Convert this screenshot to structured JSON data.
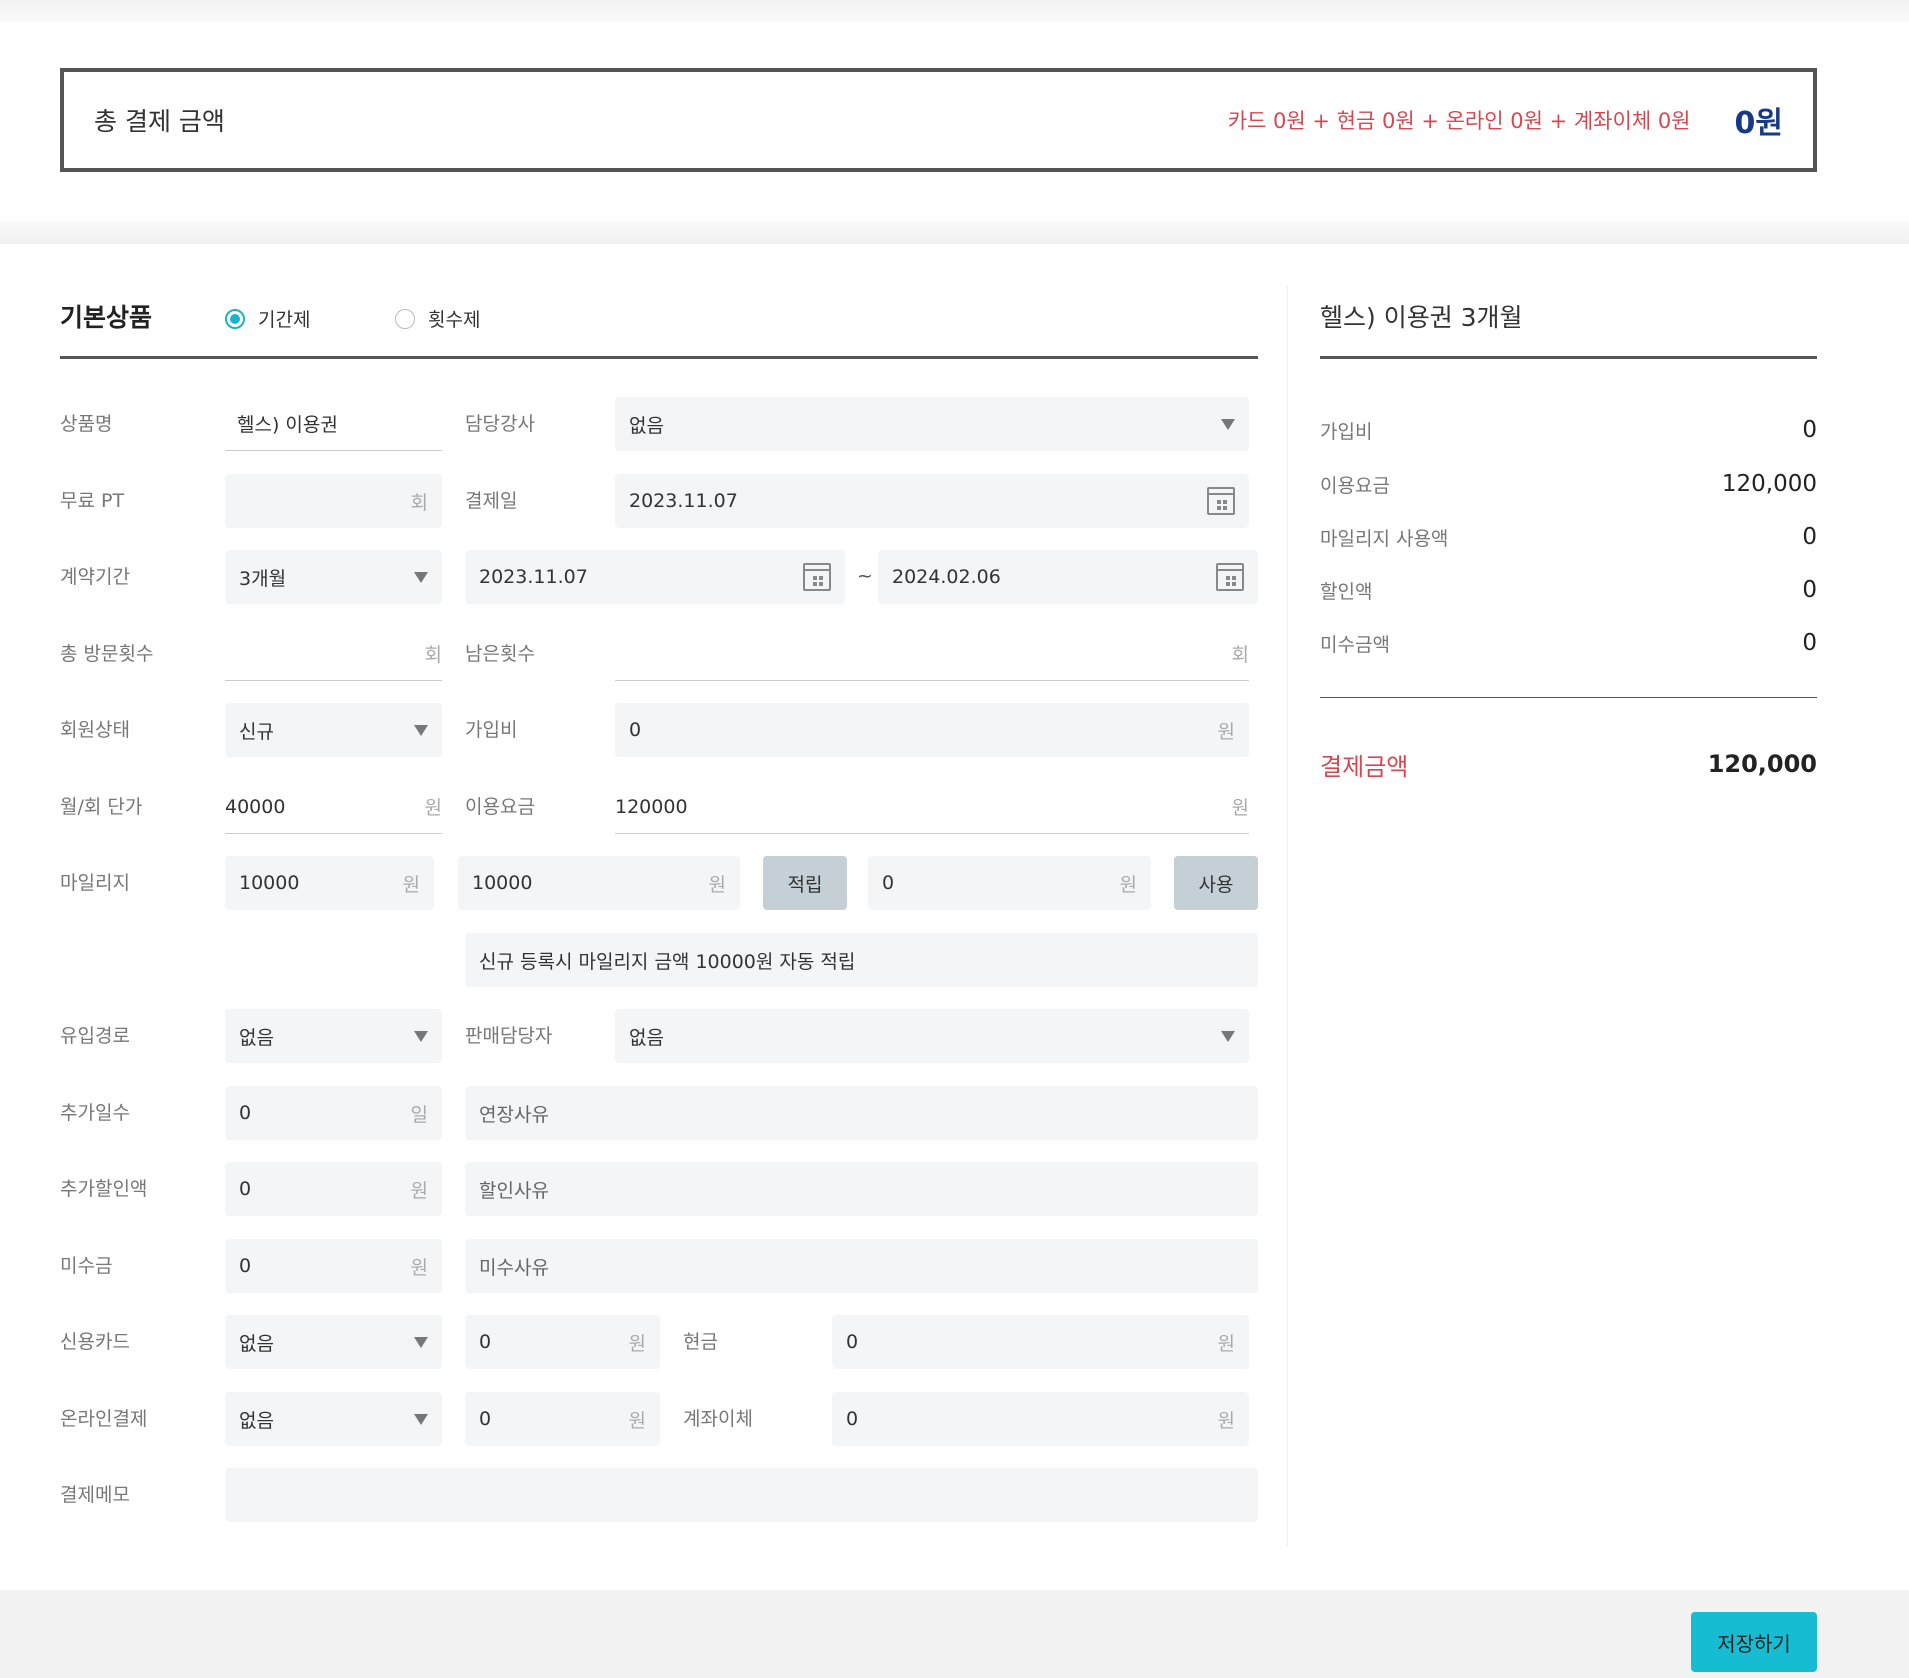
{
  "total": {
    "label": "총 결제 금액",
    "breakdown": "카드 0원 + 현금 0원 + 온라인 0원 + 계좌이체 0원",
    "amount": "0원"
  },
  "section": {
    "title": "기본상품",
    "radio_period": "기간제",
    "radio_count": "횟수제",
    "selected": "기간제"
  },
  "form": {
    "product_name": {
      "label": "상품명",
      "value": "헬스) 이용권"
    },
    "instructor": {
      "label": "담당강사",
      "value": "없음"
    },
    "free_pt": {
      "label": "무료 PT",
      "value": "",
      "unit": "회"
    },
    "pay_date": {
      "label": "결제일",
      "value": "2023.11.07"
    },
    "contract": {
      "label": "계약기간",
      "value": "3개월",
      "start": "2023.11.07",
      "end": "2024.02.06",
      "tilde": "~"
    },
    "total_visits": {
      "label": "총 방문횟수",
      "value": "",
      "unit": "회"
    },
    "remaining": {
      "label": "남은횟수",
      "value": "",
      "unit": "회"
    },
    "member_status": {
      "label": "회원상태",
      "value": "신규"
    },
    "join_fee": {
      "label": "가입비",
      "value": "0",
      "unit": "원"
    },
    "unit_price": {
      "label": "월/회 단가",
      "value": "40000",
      "unit": "원"
    },
    "usage_fee": {
      "label": "이용요금",
      "value": "120000",
      "unit": "원"
    },
    "mileage": {
      "label": "마일리지",
      "balance": "10000",
      "earn_amount": "10000",
      "earn_button": "적립",
      "use_amount": "0",
      "use_button": "사용",
      "unit": "원",
      "notice": "신규 등록시 마일리지 금액 10000원 자동 적립"
    },
    "inflow": {
      "label": "유입경로",
      "value": "없음"
    },
    "seller": {
      "label": "판매담당자",
      "value": "없음"
    },
    "extra_days": {
      "label": "추가일수",
      "value": "0",
      "unit": "일",
      "reason_placeholder": "연장사유"
    },
    "extra_discount": {
      "label": "추가할인액",
      "value": "0",
      "unit": "원",
      "reason_placeholder": "할인사유"
    },
    "unpaid": {
      "label": "미수금",
      "value": "0",
      "unit": "원",
      "reason_placeholder": "미수사유"
    },
    "credit_card": {
      "label": "신용카드",
      "select": "없음",
      "amount": "0",
      "unit": "원"
    },
    "cash": {
      "label": "현금",
      "amount": "0",
      "unit": "원"
    },
    "online": {
      "label": "온라인결제",
      "select": "없음",
      "amount": "0",
      "unit": "원"
    },
    "transfer": {
      "label": "계좌이체",
      "amount": "0",
      "unit": "원"
    },
    "memo": {
      "label": "결제메모",
      "value": ""
    }
  },
  "summary": {
    "title": "헬스) 이용권 3개월",
    "rows": [
      {
        "label": "가입비",
        "value": "0"
      },
      {
        "label": "이용요금",
        "value": "120,000"
      },
      {
        "label": "마일리지 사용액",
        "value": "0"
      },
      {
        "label": "할인액",
        "value": "0"
      },
      {
        "label": "미수금액",
        "value": "0"
      }
    ],
    "pay_label": "결제금액",
    "pay_value": "120,000"
  },
  "save_button": "저장하기",
  "colors": {
    "accent": "#16bcd1",
    "total_blue": "#173a86",
    "alert_red": "#d8474f"
  }
}
